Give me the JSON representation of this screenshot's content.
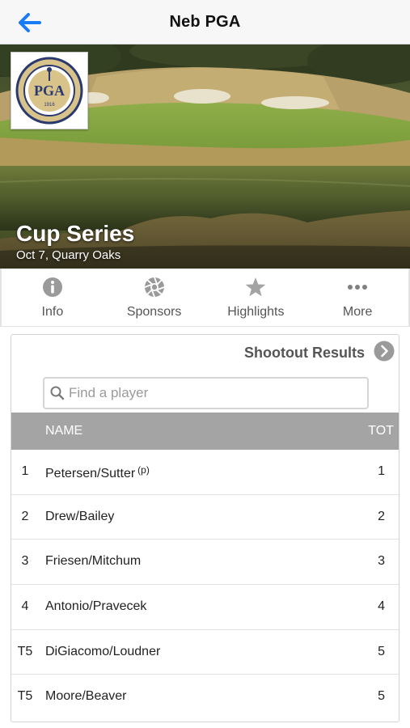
{
  "navbar": {
    "title": "Neb PGA",
    "back_icon": "arrow-left-icon",
    "accent_color": "#1a7cf5"
  },
  "hero": {
    "title": "Cup Series",
    "subtitle": "Oct 7, Quarry Oaks",
    "logo_ring_text": "PROFESSIONAL GOLFERS' ASSOCIATION OF AMERICA",
    "logo_center_text": "PGA",
    "logo_year": "1916"
  },
  "tabs": [
    {
      "label": "Info",
      "icon": "info-icon"
    },
    {
      "label": "Sponsors",
      "icon": "aperture-icon"
    },
    {
      "label": "Highlights",
      "icon": "star-icon"
    },
    {
      "label": "More",
      "icon": "ellipsis-icon"
    }
  ],
  "results": {
    "title": "Shootout Results",
    "search_placeholder": "Find a player",
    "search_value": "",
    "columns": {
      "name": "NAME",
      "total": "TOT"
    },
    "rows": [
      {
        "pos": "1",
        "name": "Petersen/Sutter",
        "note": "(p)",
        "tot": "1"
      },
      {
        "pos": "2",
        "name": "Drew/Bailey",
        "note": "",
        "tot": "2"
      },
      {
        "pos": "3",
        "name": "Friesen/Mitchum",
        "note": "",
        "tot": "3"
      },
      {
        "pos": "4",
        "name": "Antonio/Pravecek",
        "note": "",
        "tot": "4"
      },
      {
        "pos": "T5",
        "name": "DiGiacomo/Loudner",
        "note": "",
        "tot": "5"
      },
      {
        "pos": "T5",
        "name": "Moore/Beaver",
        "note": "",
        "tot": "5"
      }
    ]
  }
}
